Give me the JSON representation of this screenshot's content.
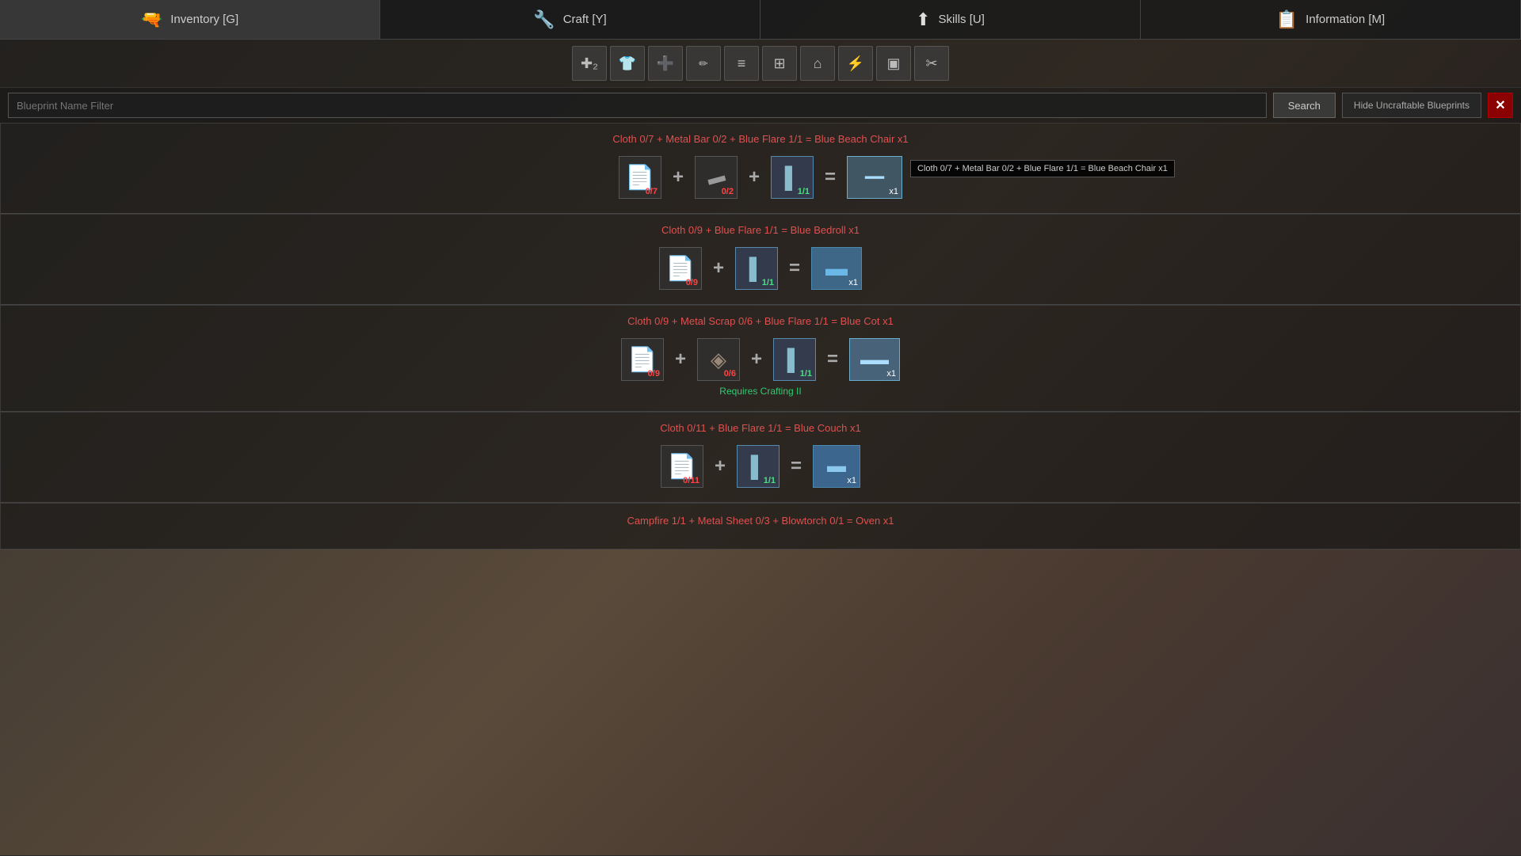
{
  "nav": {
    "items": [
      {
        "id": "inventory",
        "label": "Inventory [G]",
        "icon": "🔫"
      },
      {
        "id": "craft",
        "label": "Craft [Y]",
        "icon": "🔧"
      },
      {
        "id": "skills",
        "label": "Skills [U]",
        "icon": "⬆"
      },
      {
        "id": "information",
        "label": "Information [M]",
        "icon": "📋"
      }
    ]
  },
  "toolbar": {
    "buttons": [
      {
        "id": "crafting-all",
        "icon": "✚₂",
        "label": "All"
      },
      {
        "id": "clothing",
        "icon": "👕",
        "label": "Clothing"
      },
      {
        "id": "medical",
        "icon": "➕",
        "label": "Medical"
      },
      {
        "id": "melee",
        "icon": "🗡",
        "label": "Melee"
      },
      {
        "id": "ranged",
        "icon": "≡",
        "label": "Ranged"
      },
      {
        "id": "ammo",
        "icon": "⊞",
        "label": "Ammo"
      },
      {
        "id": "housing",
        "icon": "⌂",
        "label": "Housing"
      },
      {
        "id": "electricity",
        "icon": "⚡",
        "label": "Electricity"
      },
      {
        "id": "storage",
        "icon": "▣",
        "label": "Storage"
      },
      {
        "id": "tools",
        "icon": "✂",
        "label": "Tools"
      }
    ]
  },
  "search": {
    "placeholder": "Blueprint Name Filter",
    "button_label": "Search",
    "hide_label": "Hide Uncraftable Blueprints"
  },
  "recipes": [
    {
      "id": "blue-beach-chair",
      "title": "Cloth 0/7 + Metal Bar 0/2 + Blue Flare 1/1 = Blue Beach Chair x1",
      "tooltip": "Cloth 0/7 + Metal Bar 0/2 + Blue Flare 1/1 = Blue Beach Chair x1",
      "show_tooltip": true,
      "requires": "",
      "ingredients": [
        {
          "icon": "📄",
          "count": "0/7",
          "ok": false
        },
        {
          "icon": "▬",
          "count": "0/2",
          "ok": false
        },
        {
          "icon": "▌",
          "count": "1/1",
          "ok": true
        }
      ],
      "result": {
        "color": "blue-light",
        "count": "x1"
      }
    },
    {
      "id": "blue-bedroll",
      "title": "Cloth 0/9 + Blue Flare 1/1 = Blue Bedroll x1",
      "tooltip": "",
      "show_tooltip": false,
      "requires": "",
      "ingredients": [
        {
          "icon": "📄",
          "count": "0/9",
          "ok": false
        },
        {
          "icon": "▌",
          "count": "1/1",
          "ok": true
        }
      ],
      "result": {
        "color": "blue",
        "count": "x1"
      }
    },
    {
      "id": "blue-cot",
      "title": "Cloth 0/9 + Metal Scrap 0/6 + Blue Flare 1/1 = Blue Cot x1",
      "tooltip": "",
      "show_tooltip": false,
      "requires": "Requires Crafting II",
      "ingredients": [
        {
          "icon": "📄",
          "count": "0/9",
          "ok": false
        },
        {
          "icon": "◈",
          "count": "0/6",
          "ok": false
        },
        {
          "icon": "▌",
          "count": "1/1",
          "ok": true
        }
      ],
      "result": {
        "color": "blue-light",
        "count": "x1"
      }
    },
    {
      "id": "blue-couch",
      "title": "Cloth 0/11 + Blue Flare 1/1 = Blue Couch x1",
      "tooltip": "",
      "show_tooltip": false,
      "requires": "",
      "ingredients": [
        {
          "icon": "📄",
          "count": "0/11",
          "ok": false
        },
        {
          "icon": "▌",
          "count": "1/1",
          "ok": true
        }
      ],
      "result": {
        "color": "blue",
        "count": "x1"
      }
    },
    {
      "id": "oven",
      "title": "Campfire 1/1 + Metal Sheet 0/3 + Blowtorch 0/1 = Oven x1",
      "tooltip": "",
      "show_tooltip": false,
      "requires": "",
      "ingredients": [],
      "result": {
        "color": "gray",
        "count": "x1"
      }
    }
  ]
}
